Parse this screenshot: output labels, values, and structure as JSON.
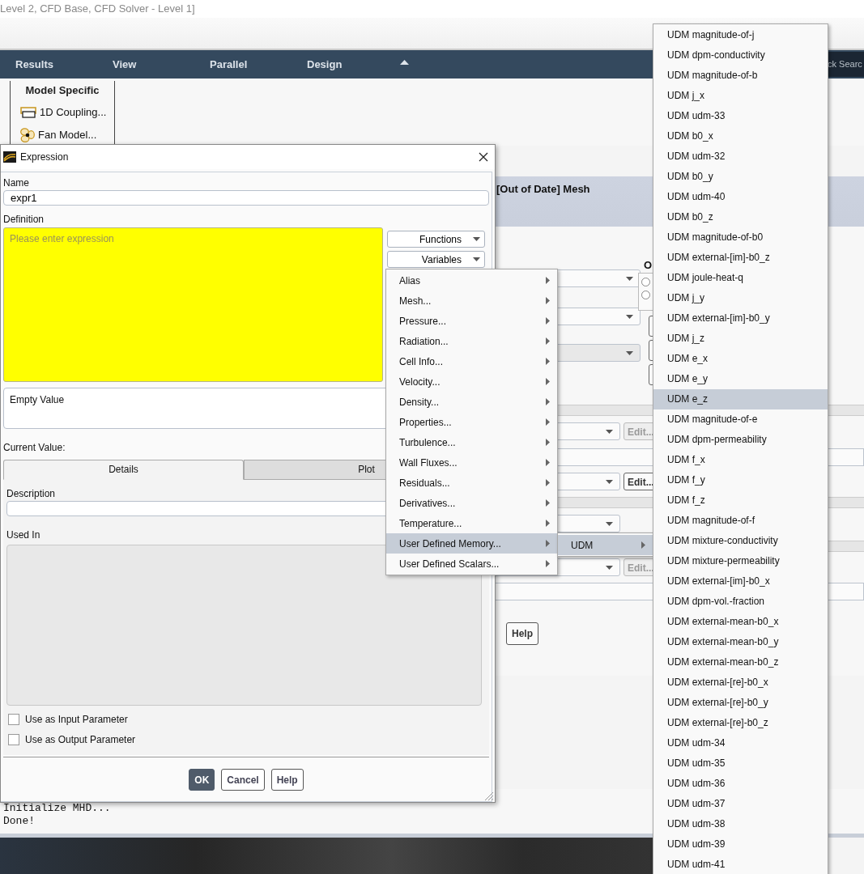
{
  "app": {
    "title": "Level 2, CFD Base, CFD Solver - Level 1]",
    "search_fragment": "ck Searc",
    "ribbon_tabs": [
      {
        "label": "Results"
      },
      {
        "label": "View"
      },
      {
        "label": "Parallel"
      },
      {
        "label": "Design"
      }
    ],
    "ribbon_group": {
      "title": "Model Specific",
      "items": [
        {
          "label": "1D Coupling...",
          "kind": "coupling"
        },
        {
          "label": "Fan Model...",
          "kind": "fan"
        }
      ]
    }
  },
  "panel": {
    "title": "[Out of Date] Mesh",
    "group_label": "O",
    "radios": [
      {
        "selected": false
      },
      {
        "selected": false
      }
    ],
    "rows": [
      {
        "kind": "select",
        "disabled": false
      },
      {
        "kind": "select",
        "disabled": false
      },
      {
        "kind": "select",
        "disabled": true
      },
      {
        "kind": "band"
      },
      {
        "kind": "select_edit",
        "edit": "Edit...",
        "disabled": true
      },
      {
        "kind": "field"
      },
      {
        "kind": "select_edit",
        "edit": "Edit...",
        "disabled": false
      },
      {
        "kind": "band"
      },
      {
        "kind": "select",
        "disabled": false
      },
      {
        "kind": "band"
      },
      {
        "kind": "select_edit",
        "edit": "Edit...",
        "disabled": true
      },
      {
        "kind": "field"
      }
    ],
    "help": "Help"
  },
  "console": {
    "lines": [
      "Initialize MHD...",
      "Done!"
    ]
  },
  "dialog": {
    "title": "Expression",
    "name_label": "Name",
    "name_value": "expr1",
    "definition_label": "Definition",
    "definition_placeholder": "Please enter expression",
    "side_buttons": [
      "Functions",
      "Variables"
    ],
    "value_display": "Empty Value",
    "current_value_label": "Current Value:",
    "tabs": [
      {
        "label": "Details",
        "selected": true
      },
      {
        "label": "Plot",
        "selected": false
      }
    ],
    "description_label": "Description",
    "used_in_label": "Used In",
    "checkboxes": [
      {
        "label": "Use as Input Parameter",
        "checked": false
      },
      {
        "label": "Use as Output Parameter",
        "checked": false
      }
    ],
    "buttons": [
      {
        "label": "OK",
        "primary": true
      },
      {
        "label": "Cancel",
        "primary": false
      },
      {
        "label": "Help",
        "primary": false
      }
    ]
  },
  "variables_menu": {
    "items": [
      {
        "label": "Alias",
        "selected": false
      },
      {
        "label": "Mesh...",
        "selected": false
      },
      {
        "label": "Pressure...",
        "selected": false
      },
      {
        "label": "Radiation...",
        "selected": false
      },
      {
        "label": "Cell Info...",
        "selected": false
      },
      {
        "label": "Velocity...",
        "selected": false
      },
      {
        "label": "Density...",
        "selected": false
      },
      {
        "label": "Properties...",
        "selected": false
      },
      {
        "label": "Turbulence...",
        "selected": false
      },
      {
        "label": "Wall Fluxes...",
        "selected": false
      },
      {
        "label": "Residuals...",
        "selected": false
      },
      {
        "label": "Derivatives...",
        "selected": false
      },
      {
        "label": "Temperature...",
        "selected": false
      },
      {
        "label": "User Defined Memory...",
        "selected": true
      },
      {
        "label": "User Defined Scalars...",
        "selected": false
      }
    ]
  },
  "udm_submenu": {
    "items": [
      {
        "label": "UDM",
        "selected": true
      }
    ]
  },
  "udm_list": {
    "items": [
      {
        "label": "UDM magnitude-of-j",
        "selected": false
      },
      {
        "label": "UDM dpm-conductivity",
        "selected": false
      },
      {
        "label": "UDM magnitude-of-b",
        "selected": false
      },
      {
        "label": "UDM j_x",
        "selected": false
      },
      {
        "label": "UDM udm-33",
        "selected": false
      },
      {
        "label": "UDM b0_x",
        "selected": false
      },
      {
        "label": "UDM udm-32",
        "selected": false
      },
      {
        "label": "UDM b0_y",
        "selected": false
      },
      {
        "label": "UDM udm-40",
        "selected": false
      },
      {
        "label": "UDM b0_z",
        "selected": false
      },
      {
        "label": "UDM magnitude-of-b0",
        "selected": false
      },
      {
        "label": "UDM external-[im]-b0_z",
        "selected": false
      },
      {
        "label": "UDM joule-heat-q",
        "selected": false
      },
      {
        "label": "UDM j_y",
        "selected": false
      },
      {
        "label": "UDM external-[im]-b0_y",
        "selected": false
      },
      {
        "label": "UDM j_z",
        "selected": false
      },
      {
        "label": "UDM e_x",
        "selected": false
      },
      {
        "label": "UDM e_y",
        "selected": false
      },
      {
        "label": "UDM e_z",
        "selected": true
      },
      {
        "label": "UDM magnitude-of-e",
        "selected": false
      },
      {
        "label": "UDM dpm-permeability",
        "selected": false
      },
      {
        "label": "UDM f_x",
        "selected": false
      },
      {
        "label": "UDM f_y",
        "selected": false
      },
      {
        "label": "UDM f_z",
        "selected": false
      },
      {
        "label": "UDM magnitude-of-f",
        "selected": false
      },
      {
        "label": "UDM mixture-conductivity",
        "selected": false
      },
      {
        "label": "UDM mixture-permeability",
        "selected": false
      },
      {
        "label": "UDM external-[im]-b0_x",
        "selected": false
      },
      {
        "label": "UDM dpm-vol.-fraction",
        "selected": false
      },
      {
        "label": "UDM external-mean-b0_x",
        "selected": false
      },
      {
        "label": "UDM external-mean-b0_y",
        "selected": false
      },
      {
        "label": "UDM external-mean-b0_z",
        "selected": false
      },
      {
        "label": "UDM external-[re]-b0_x",
        "selected": false
      },
      {
        "label": "UDM external-[re]-b0_y",
        "selected": false
      },
      {
        "label": "UDM external-[re]-b0_z",
        "selected": false
      },
      {
        "label": "UDM udm-34",
        "selected": false
      },
      {
        "label": "UDM udm-35",
        "selected": false
      },
      {
        "label": "UDM udm-36",
        "selected": false
      },
      {
        "label": "UDM udm-37",
        "selected": false
      },
      {
        "label": "UDM udm-38",
        "selected": false
      },
      {
        "label": "UDM udm-39",
        "selected": false
      },
      {
        "label": "UDM udm-41",
        "selected": false
      }
    ]
  }
}
